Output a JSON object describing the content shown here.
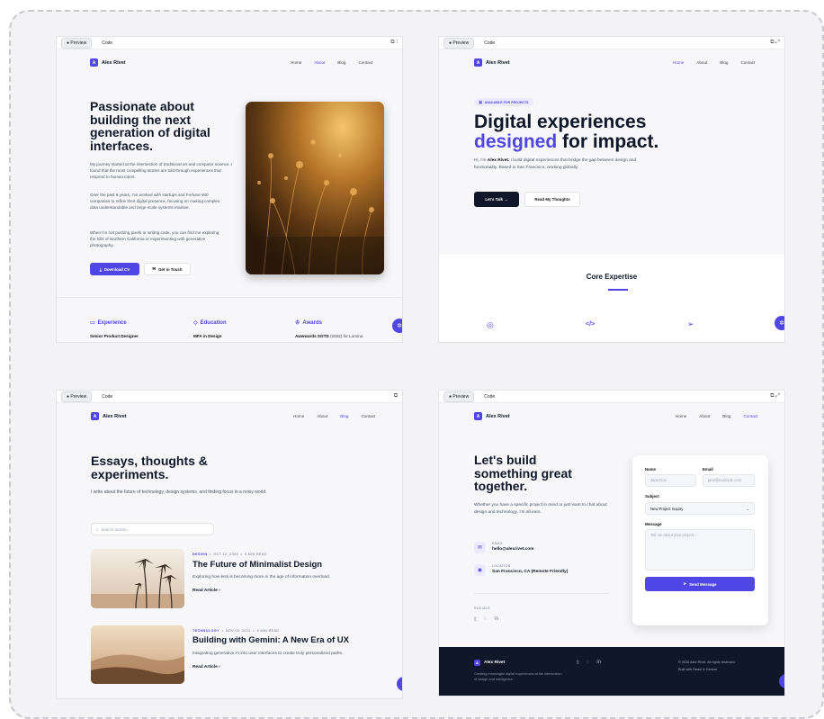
{
  "toolbar": {
    "preview": "● Preview",
    "code": "Code"
  },
  "brand": {
    "name": "Alex Rivet",
    "initial": "A"
  },
  "nav": {
    "home": "Home",
    "about": "About",
    "blog": "Blog",
    "contact": "Contact"
  },
  "about": {
    "title": "Passionate about building the next generation of digital interfaces.",
    "p1": "My journey started at the intersection of traditional art and computer science. I found that the most compelling stories are told through experiences that respond to human intent.",
    "p2": "Over the past 8 years, I've worked with startups and Fortune 500 companies to refine their digital presence, focusing on making complex data understandable and large-scale systems intuitive.",
    "p3": "When I'm not pushing pixels or writing code, you can find me exploring the hills of Northern California or experimenting with generative photography.",
    "download": "Download CV",
    "touch": "Get in Touch",
    "experience": "Experience",
    "education": "Education",
    "awards": "Awards",
    "exp_value": "Senior Product Designer",
    "edu_value": "MFA in Design",
    "award_bold": "Awwwards SOTD",
    "award_rest": " (2022) for Lumina."
  },
  "home": {
    "badge": "AVAILABLE FOR PROJECTS",
    "title1": "Digital experiences",
    "title2a": "designed",
    "title2b": " for impact.",
    "intro_a": "Hi, I'm ",
    "intro_name": "Alex Rivet.",
    "intro_b": " I build digital experiences that bridge the gap between design and functionality. Based in San Francisco, working globally.",
    "talk": "Let's Talk →",
    "thoughts": "Read My Thoughts",
    "expertise": "Core Expertise"
  },
  "blog": {
    "title": "Essays, thoughts & experiments.",
    "sub": "I write about the future of technology, design systems, and finding focus in a noisy world.",
    "search_placeholder": "Search articles...",
    "posts": [
      {
        "cat": "DESIGN",
        "date": "OCT 12, 2023",
        "read": "5 MIN READ",
        "title": "The Future of Minimalist Design",
        "excerpt": "Exploring how less is becoming more in the age of information overload.",
        "link": "Read Article"
      },
      {
        "cat": "TECHNOLOGY",
        "date": "NOV 05, 2023",
        "read": "8 MIN READ",
        "title": "Building with Gemini: A New Era of UX",
        "excerpt": "Integrating generative AI into user interfaces to create truly personalized paths.",
        "link": "Read Article"
      }
    ]
  },
  "contact": {
    "title": "Let's build something great together.",
    "sub": "Whether you have a specific project in mind or just want to chat about design and technology, I'm all ears.",
    "email_label": "EMAIL",
    "email": "hello@alexrivet.com",
    "loc_label": "LOCATION",
    "loc": "San Francisco, CA (Remote Friendly)",
    "socials": "SOCIALS",
    "f_name": "Name",
    "f_name_ph": "Jane Doe",
    "f_email": "Email",
    "f_email_ph": "jane@example.com",
    "f_subject": "Subject",
    "f_subject_val": "New Project Inquiry",
    "f_msg": "Message",
    "f_msg_ph": "Tell me about your project...",
    "send": "Send Message"
  },
  "footer": {
    "brand": "Alex Rivet",
    "tag": "Creating meaningful digital experiences at the intersection of design and intelligence.",
    "copy": "© 2026 Alex Rivet. All rights reserved.",
    "built": "Built with React & Gemini"
  },
  "colors": {
    "accent": "#4f46e5",
    "dark": "#0f1729"
  }
}
